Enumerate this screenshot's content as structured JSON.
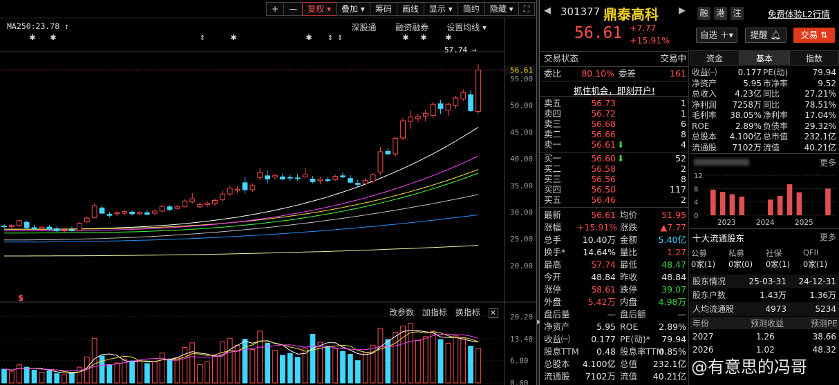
{
  "toolbar": [
    "+",
    "—",
    "复权",
    "叠加",
    "筹码",
    "画线",
    "显示",
    "简约",
    "隐藏",
    "⛶"
  ],
  "ma_label": "MA250:23.78",
  "chart_links": [
    "深股通",
    "融资融券",
    "设置均线"
  ],
  "high_mark": "57.74",
  "price_axis": [
    "55.00",
    "50.00",
    "45.00",
    "40.00",
    "35.00",
    "30.00",
    "25.00",
    "20.00"
  ],
  "current_price_tag": "56.61",
  "sub_links": [
    "改参数",
    "加指标",
    "换指标"
  ],
  "vol_axis": [
    "20.20",
    "13.40",
    "6.80",
    "0.00"
  ],
  "colors": {
    "up": "#ff4d4d",
    "down": "#3fd7ff",
    "bg": "#000000"
  },
  "chart_data": {
    "type": "candlestick",
    "ylim": [
      16.5,
      59
    ],
    "candles": [
      [
        27.4,
        27.8,
        27.0,
        27.3
      ],
      [
        27.3,
        27.7,
        26.8,
        27.5
      ],
      [
        27.5,
        28.6,
        27.2,
        28.4
      ],
      [
        28.1,
        28.4,
        26.9,
        27.1
      ],
      [
        27.1,
        27.6,
        26.7,
        26.9
      ],
      [
        26.9,
        27.4,
        26.6,
        27.2
      ],
      [
        27.2,
        27.6,
        26.6,
        26.8
      ],
      [
        26.9,
        27.3,
        26.3,
        26.5
      ],
      [
        26.6,
        27.0,
        26.2,
        26.7
      ],
      [
        26.7,
        27.3,
        26.4,
        26.5
      ],
      [
        26.5,
        28.2,
        26.4,
        27.9
      ],
      [
        28.2,
        29.2,
        27.9,
        28.9
      ],
      [
        29.0,
        31.5,
        28.8,
        31.2
      ],
      [
        30.8,
        31.3,
        29.6,
        29.8
      ],
      [
        29.6,
        30.0,
        29.1,
        29.4
      ],
      [
        29.7,
        30.2,
        29.3,
        29.9
      ],
      [
        29.8,
        30.4,
        29.4,
        30.1
      ],
      [
        30.0,
        30.3,
        29.4,
        29.7
      ],
      [
        29.7,
        30.2,
        29.5,
        30.0
      ],
      [
        29.9,
        30.3,
        29.4,
        29.6
      ],
      [
        29.8,
        30.4,
        29.5,
        30.2
      ],
      [
        30.2,
        31.4,
        30.0,
        31.1
      ],
      [
        31.0,
        31.3,
        30.2,
        30.5
      ],
      [
        30.7,
        31.3,
        30.5,
        31.0
      ],
      [
        31.0,
        32.4,
        30.9,
        32.1
      ],
      [
        31.9,
        33.6,
        31.6,
        32.5
      ],
      [
        31.0,
        31.8,
        30.7,
        31.4
      ],
      [
        31.4,
        32.1,
        31.0,
        31.7
      ],
      [
        31.6,
        32.6,
        31.2,
        32.2
      ],
      [
        32.3,
        34.0,
        32.1,
        33.4
      ],
      [
        33.4,
        35.0,
        33.1,
        34.5
      ],
      [
        34.1,
        34.9,
        33.6,
        34.3
      ],
      [
        35.5,
        36.6,
        33.5,
        34.2
      ],
      [
        34.2,
        35.4,
        33.8,
        35.0
      ],
      [
        36.5,
        38.3,
        36.0,
        37.4
      ],
      [
        36.8,
        37.8,
        35.4,
        36.2
      ],
      [
        36.6,
        37.1,
        36.1,
        36.9
      ],
      [
        36.6,
        37.2,
        36.0,
        36.2
      ],
      [
        36.5,
        37.0,
        35.8,
        36.4
      ],
      [
        36.4,
        37.2,
        35.8,
        36.3
      ],
      [
        36.6,
        38.3,
        36.3,
        37.0
      ],
      [
        36.2,
        36.8,
        35.4,
        35.7
      ],
      [
        35.9,
        36.6,
        35.2,
        36.2
      ],
      [
        36.1,
        36.6,
        35.6,
        35.9
      ],
      [
        36.1,
        37.0,
        35.8,
        36.7
      ],
      [
        36.8,
        37.4,
        36.4,
        36.6
      ],
      [
        36.3,
        36.9,
        35.3,
        35.6
      ],
      [
        35.4,
        36.0,
        34.6,
        35.2
      ],
      [
        35.3,
        36.4,
        34.9,
        35.9
      ],
      [
        35.8,
        37.3,
        35.4,
        37.0
      ],
      [
        37.5,
        42.2,
        37.0,
        41.3
      ],
      [
        41.4,
        42.0,
        40.8,
        40.9
      ],
      [
        40.9,
        44.1,
        40.5,
        43.8
      ],
      [
        43.9,
        47.6,
        43.5,
        47.1
      ],
      [
        47.0,
        49.0,
        45.6,
        47.8
      ],
      [
        47.5,
        48.4,
        46.8,
        47.9
      ],
      [
        48.0,
        49.2,
        47.0,
        48.5
      ],
      [
        48.1,
        50.6,
        47.6,
        50.2
      ],
      [
        50.3,
        51.0,
        48.4,
        49.4
      ],
      [
        49.1,
        50.5,
        48.0,
        50.2
      ],
      [
        50.0,
        51.8,
        49.3,
        51.4
      ],
      [
        51.2,
        53.0,
        50.8,
        52.4
      ],
      [
        52.0,
        52.8,
        48.7,
        49.0
      ],
      [
        48.84,
        57.74,
        48.47,
        56.61
      ]
    ],
    "ma_lines": [
      {
        "color": "#ffffff",
        "start": 26.8,
        "end": 45.9
      },
      {
        "color": "#f0e040",
        "start": 26.8,
        "end": 38.0
      },
      {
        "color": "#ff40ff",
        "start": 26.5,
        "end": 40.5
      },
      {
        "color": "#40ff40",
        "start": 26.1,
        "end": 37.3
      },
      {
        "color": "#c0c0c0",
        "start": 24.8,
        "end": 33.3
      },
      {
        "color": "#2090ff",
        "start": 24.4,
        "end": 29.5
      },
      {
        "color": "#f0f0a0",
        "start": 21.8,
        "end": 23.78
      }
    ],
    "volume_ylim": [
      0,
      21
    ],
    "volume": [
      4.2,
      3.6,
      5.5,
      4.8,
      3.9,
      3.2,
      3.6,
      2.8,
      2.5,
      3.1,
      4.8,
      7.9,
      13.6,
      8.2,
      5.6,
      6.1,
      7.2,
      6.7,
      6.8,
      5.9,
      6.4,
      9.1,
      7.3,
      7.8,
      10.8,
      12.2,
      5.6,
      6.4,
      8.3,
      12.5,
      13.6,
      11.4,
      13.3,
      10.2,
      15.8,
      12.1,
      9.9,
      8.4,
      9.0,
      7.8,
      10.6,
      14.8,
      12.4,
      11.2,
      10.5,
      9.6,
      8.7,
      6.8,
      9.3,
      11.4,
      16.6,
      13.2,
      15.4,
      17.3,
      18.1,
      12.9,
      14.1,
      15.8,
      13.2,
      12.1,
      14.3,
      13.6,
      11.2,
      10.6
    ]
  },
  "quote": {
    "code": "301377",
    "name": "鼎泰高科",
    "price": "56.61",
    "change": "+7.77",
    "pct": "+15.91%",
    "tags": [
      "融",
      "港",
      "注"
    ],
    "free_l2": "免费体验L2行情",
    "btn_watch": "自选",
    "btn_alert": "提醒",
    "btn_trade": "交易"
  },
  "trade_state": {
    "label": "交易状态",
    "value": "交易中"
  },
  "ratio": {
    "label1": "委比",
    "value1": "80.10%",
    "label2": "委差",
    "value2": "161"
  },
  "open_account": "抓住机会，即刻开户!",
  "sells": [
    {
      "label": "卖五",
      "price": "56.73",
      "vol": "1"
    },
    {
      "label": "卖四",
      "price": "56.72",
      "vol": "1"
    },
    {
      "label": "卖三",
      "price": "56.68",
      "vol": "6"
    },
    {
      "label": "卖二",
      "price": "56.66",
      "vol": "8"
    },
    {
      "label": "卖一",
      "price": "56.61",
      "vol": "4"
    }
  ],
  "buys": [
    {
      "label": "买一",
      "price": "56.60",
      "vol": "52"
    },
    {
      "label": "买二",
      "price": "56.58",
      "vol": "2"
    },
    {
      "label": "买三",
      "price": "56.56",
      "vol": "8"
    },
    {
      "label": "买四",
      "price": "56.50",
      "vol": "117"
    },
    {
      "label": "买五",
      "price": "56.46",
      "vol": "2"
    }
  ],
  "stats": [
    [
      "最新",
      "56.61",
      "均价",
      "51.95"
    ],
    [
      "涨幅",
      "+15.91%",
      "涨跌",
      "▲7.77"
    ],
    [
      "总手",
      "10.40万",
      "金额",
      "5.40亿"
    ],
    [
      "换手*",
      "14.64%",
      "量比",
      "1.27"
    ],
    [
      "最高",
      "57.74",
      "最低",
      "48.47"
    ],
    [
      "今开",
      "48.84",
      "昨收",
      "48.84"
    ],
    [
      "涨停",
      "58.61",
      "跌停",
      "39.07"
    ],
    [
      "外盘",
      "5.42万",
      "内盘",
      "4.98万"
    ],
    [
      "盘后量",
      "—",
      "盘后额",
      "—"
    ],
    [
      "净资产",
      "5.95",
      "ROE",
      "2.89%"
    ],
    [
      "收益㈠",
      "0.177",
      "PE(动)*",
      "79.94"
    ],
    [
      "股息TTM",
      "0.48",
      "股息率TTM",
      "0.85%"
    ],
    [
      "总股本",
      "4.100亿",
      "总值",
      "232.1亿"
    ],
    [
      "流通股",
      "7102万",
      "流值",
      "40.21亿"
    ]
  ],
  "tabs": [
    "资金",
    "基本",
    "指数"
  ],
  "fundamentals": [
    [
      "收益㈠",
      "0.177",
      "PE(动)",
      "79.94"
    ],
    [
      "净资产",
      "5.95",
      "市净率",
      "9.52"
    ],
    [
      "总收入",
      "4.23亿",
      "同比",
      "27.21%"
    ],
    [
      "净利润",
      "7258万",
      "同比",
      "78.51%"
    ],
    [
      "毛利率",
      "38.05%",
      "净利率",
      "17.04%"
    ],
    [
      "ROE",
      "2.89%",
      "负债率",
      "29.32%"
    ],
    [
      "总股本",
      "4.100亿",
      "总市值",
      "232.1亿"
    ],
    [
      "流通股",
      "7102万",
      "流值",
      "40.21亿"
    ]
  ],
  "more": "更多",
  "mini_bar": {
    "type": "bar",
    "y_ticks": [
      "12",
      "8",
      "4",
      "0"
    ],
    "ylim": [
      0,
      12
    ],
    "years": [
      "2023",
      "2024",
      "2025"
    ],
    "values": [
      7.7,
      7.0,
      6.3,
      5.6,
      0,
      0,
      4.7,
      5.8,
      9.3,
      6.9,
      0,
      0,
      8.0
    ]
  },
  "holders_title": "十大流通股东",
  "holder_types": [
    "公募",
    "私募",
    "社保",
    "QFII"
  ],
  "holder_counts": [
    "0家(1)",
    "0家(0)",
    "0家(1)",
    "0家(1)"
  ],
  "holder_table": [
    [
      "股东情况",
      "25-03-31",
      "24-12-31"
    ],
    [
      "股东户数",
      "1.43万",
      "1.36万"
    ],
    [
      "人均流通股",
      "4973",
      "5234"
    ]
  ],
  "forecast_head": [
    "年份",
    "预测收益",
    "预测PE"
  ],
  "forecast": [
    [
      "2027",
      "1.26",
      "38.66"
    ],
    [
      "2026",
      "1.02",
      "48.32"
    ]
  ],
  "watermark": "@有意思的冯哥"
}
